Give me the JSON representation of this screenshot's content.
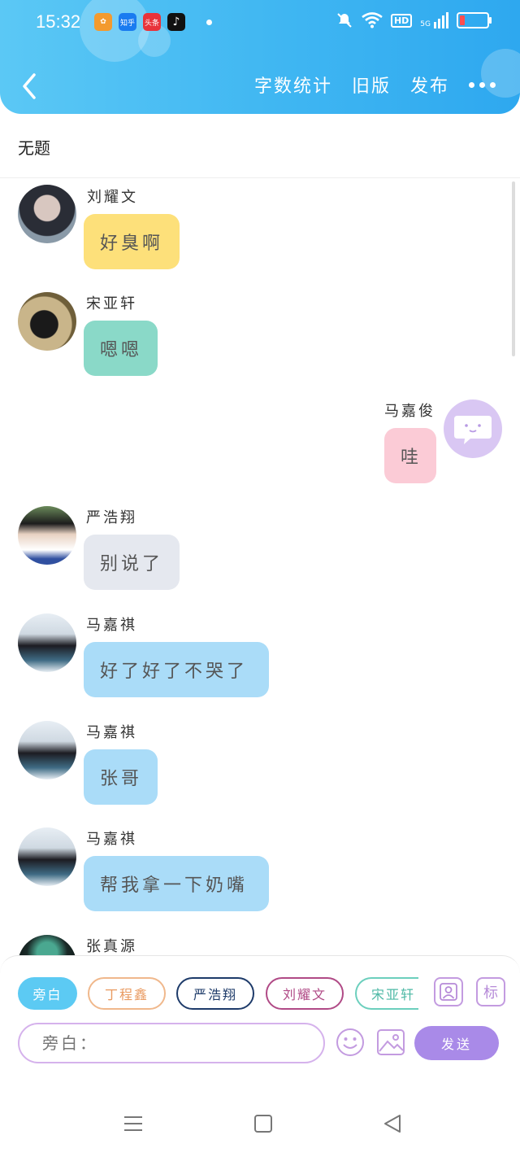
{
  "status_bar": {
    "time": "15:32",
    "notifications": [
      "app-icon-1",
      "知乎",
      "头条",
      "tiktok-icon"
    ],
    "network": "5G",
    "hd": "HD"
  },
  "header": {
    "actions": [
      "字数统计",
      "旧版",
      "发布"
    ],
    "more_icon": "more-dots-icon"
  },
  "title": "无题",
  "messages": [
    {
      "name": "刘耀文",
      "text": "好臭啊",
      "side": "left",
      "bubble_color": "#fde07a"
    },
    {
      "name": "宋亚轩",
      "text": "嗯嗯",
      "side": "left",
      "bubble_color": "#8ad9c8"
    },
    {
      "name": "马嘉俊",
      "text": "哇",
      "side": "right",
      "bubble_color": "#fbcbd6"
    },
    {
      "name": "严浩翔",
      "text": "别说了",
      "side": "left",
      "bubble_color": "#e5e8ef"
    },
    {
      "name": "马嘉祺",
      "text": "好了好了不哭了",
      "side": "left",
      "bubble_color": "#aadcf8"
    },
    {
      "name": "马嘉祺",
      "text": "张哥",
      "side": "left",
      "bubble_color": "#aadcf8"
    },
    {
      "name": "马嘉祺",
      "text": "帮我拿一下奶嘴",
      "side": "left",
      "bubble_color": "#aadcf8"
    },
    {
      "name": "张真源",
      "text": "",
      "side": "left",
      "bubble_color": "#aadcf8"
    }
  ],
  "role_chips": [
    "旁白",
    "丁程鑫",
    "严浩翔",
    "刘耀文",
    "宋亚轩"
  ],
  "square_buttons": {
    "role_icon": "person-card-icon",
    "tag_label": "标"
  },
  "input": {
    "placeholder": "旁白："
  },
  "send_label": "发送",
  "colors": {
    "header": "#3fb6f2",
    "send": "#a98ae8",
    "chip_active": "#5ccaf3"
  }
}
